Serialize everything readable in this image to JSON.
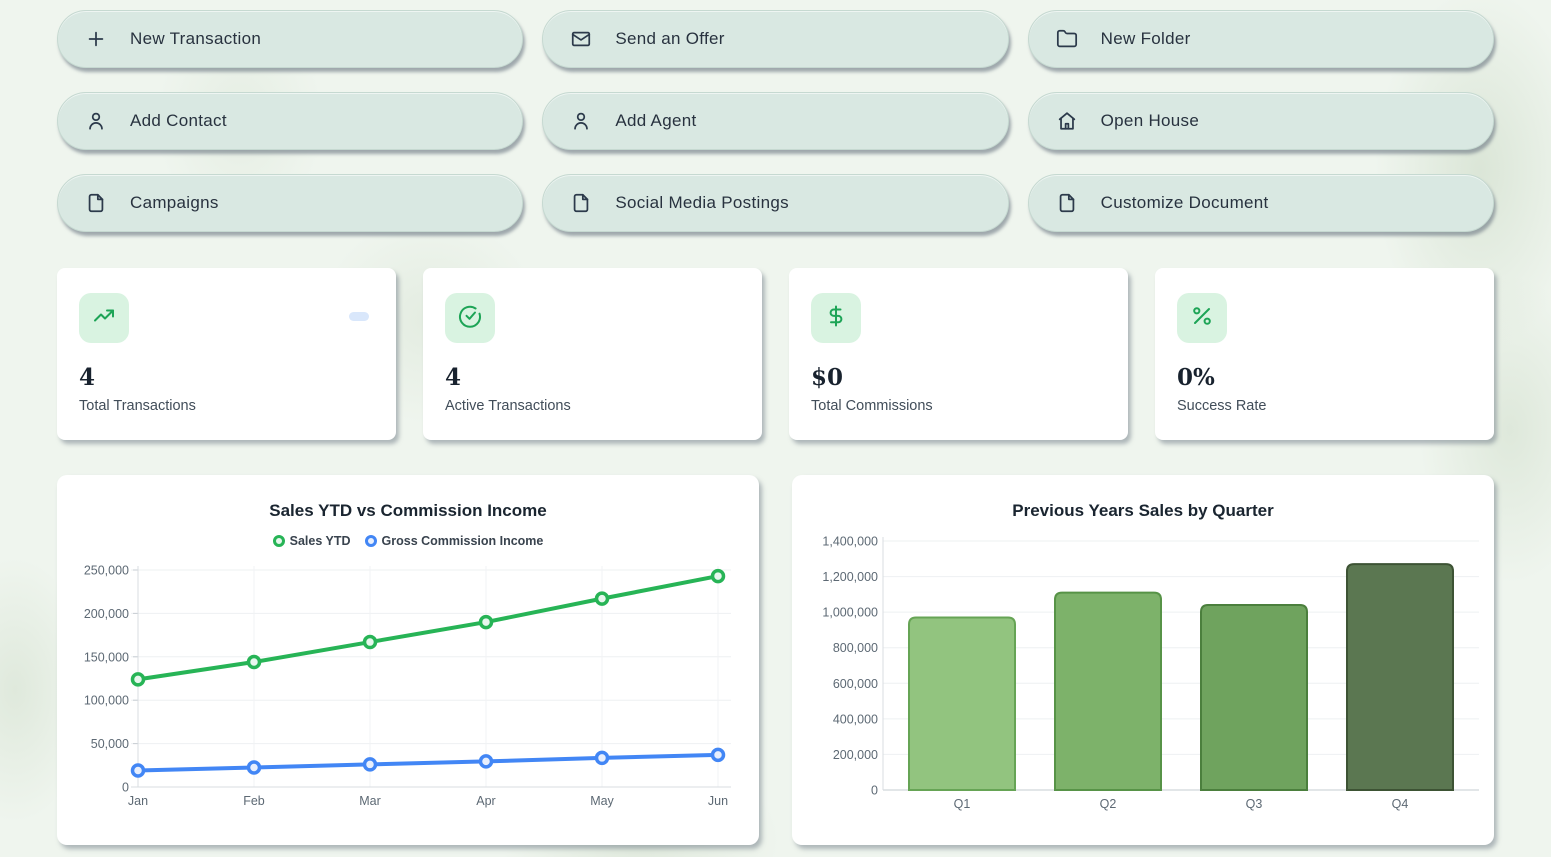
{
  "quick_actions": [
    {
      "label": "New Transaction",
      "icon": "plus-icon"
    },
    {
      "label": "Send an Offer",
      "icon": "mail-icon"
    },
    {
      "label": "New Folder",
      "icon": "folder-icon"
    },
    {
      "label": "Add Contact",
      "icon": "person-icon"
    },
    {
      "label": "Add Agent",
      "icon": "person-icon"
    },
    {
      "label": "Open House",
      "icon": "home-icon"
    },
    {
      "label": "Campaigns",
      "icon": "file-icon"
    },
    {
      "label": "Social Media Postings",
      "icon": "file-icon"
    },
    {
      "label": "Customize Document",
      "icon": "file-icon"
    }
  ],
  "stats": [
    {
      "value": "4",
      "label": "Total Transactions",
      "icon": "trending-up-icon"
    },
    {
      "value": "4",
      "label": "Active Transactions",
      "icon": "check-circle-icon"
    },
    {
      "value": "$0",
      "label": "Total Commissions",
      "icon": "dollar-icon"
    },
    {
      "value": "0%",
      "label": "Success Rate",
      "icon": "percent-icon"
    }
  ],
  "colors": {
    "page_background": "#eff5ee",
    "button_background": "#d9e8e2",
    "card_background": "#ffffff",
    "stat_icon_tile": "#d9f3e1",
    "stat_icon_green": "#1da456",
    "mini_badge_blue": "#d9e7fb",
    "grid_line": "#eef0f2",
    "axis_line": "#d9dde1",
    "tick_text": "#5d6974"
  },
  "chart_data": [
    {
      "type": "line",
      "title": "Sales YTD vs Commission Income",
      "x": [
        "Jan",
        "Feb",
        "Mar",
        "Apr",
        "May",
        "Jun"
      ],
      "series": [
        {
          "name": "Sales YTD",
          "color": "#27b456",
          "point_fill": "#e8f7ee",
          "values": [
            124000,
            144000,
            167000,
            190000,
            217000,
            243000
          ]
        },
        {
          "name": "Gross Commission Income",
          "color": "#4286f5",
          "point_fill": "#e8effd",
          "values": [
            19000,
            22500,
            26000,
            29500,
            33500,
            37000
          ]
        }
      ],
      "ylim": [
        0,
        250000
      ],
      "ytick": 50000,
      "legend_position": "top",
      "grid": true
    },
    {
      "type": "bar",
      "title": "Previous Years Sales by Quarter",
      "categories": [
        "Q1",
        "Q2",
        "Q3",
        "Q4"
      ],
      "values": [
        970000,
        1110000,
        1040000,
        1270000
      ],
      "bar_colors": [
        "#92c47f",
        "#7db26a",
        "#6fa35e",
        "#5b7751"
      ],
      "bar_borders": [
        "#66a455",
        "#579347",
        "#4b7f3d",
        "#3d5334"
      ],
      "ylim": [
        0,
        1400000
      ],
      "ytick": 200000,
      "legend_position": "none",
      "grid": true
    }
  ]
}
